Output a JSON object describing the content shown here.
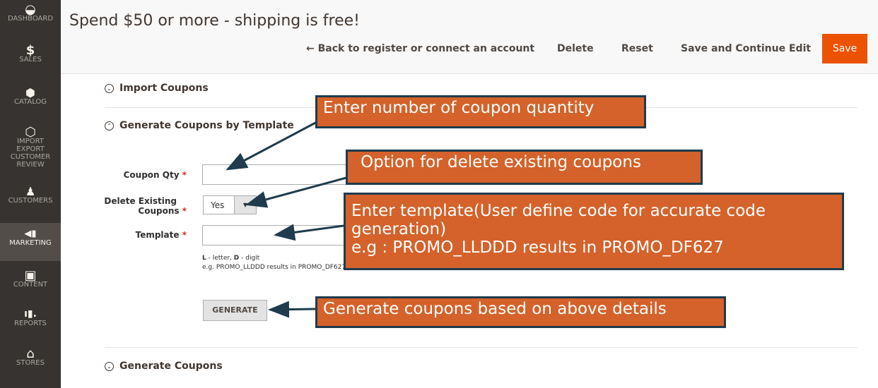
{
  "sidebar": {
    "items": [
      {
        "label": "DASHBOARD",
        "icon": "dashboard-icon",
        "glyph": "◒"
      },
      {
        "label": "SALES",
        "icon": "dollar-icon",
        "glyph": "$"
      },
      {
        "label": "CATALOG",
        "icon": "box-icon",
        "glyph": "⬢"
      },
      {
        "label": "IMPORT EXPORT CUSTOMER REVIEW",
        "icon": "hexagon-icon",
        "glyph": "⬡"
      },
      {
        "label": "CUSTOMERS",
        "icon": "person-icon",
        "glyph": "♟"
      },
      {
        "label": "MARKETING",
        "icon": "megaphone-icon",
        "glyph": "📢"
      },
      {
        "label": "CONTENT",
        "icon": "layout-icon",
        "glyph": "▣"
      },
      {
        "label": "REPORTS",
        "icon": "bar-chart-icon",
        "glyph": "▮"
      },
      {
        "label": "STORES",
        "icon": "store-icon",
        "glyph": "⌂"
      }
    ]
  },
  "header": {
    "title": "Spend $50 or more - shipping is free!",
    "back_label": "← Back to register or connect an account",
    "delete_label": "Delete",
    "reset_label": "Reset",
    "save_continue_label": "Save and Continue Edit",
    "save_label": "Save"
  },
  "sections": {
    "import": "Import Coupons",
    "generate_template": "Generate Coupons by Template",
    "generate": "Generate Coupons"
  },
  "form": {
    "coupon_qty_label": "Coupon Qty",
    "delete_existing_label_1": "Delete Existing",
    "delete_existing_label_2": "Coupons",
    "delete_existing_value": "Yes",
    "template_label": "Template",
    "required_mark": "*",
    "note_l": "L",
    "note_l_text": " - letter, ",
    "note_d": "D",
    "note_d_text": " - digit",
    "note_example": "e.g. PROMO_LLDDD results in PROMO_DF627",
    "generate_button": "GENERATE"
  },
  "callouts": {
    "qty": "Enter number of coupon quantity",
    "delete": "Option for delete existing coupons",
    "template_1": "Enter template(User define code for accurate code",
    "template_2": "generation)",
    "template_3": "e.g : PROMO_LLDDD results in PROMO_DF627",
    "generate": "Generate coupons based on above details"
  },
  "colors": {
    "sidebar_bg": "#373330",
    "accent": "#eb5202",
    "callout_bg": "#d4622a",
    "callout_border": "#1f3b4d"
  }
}
